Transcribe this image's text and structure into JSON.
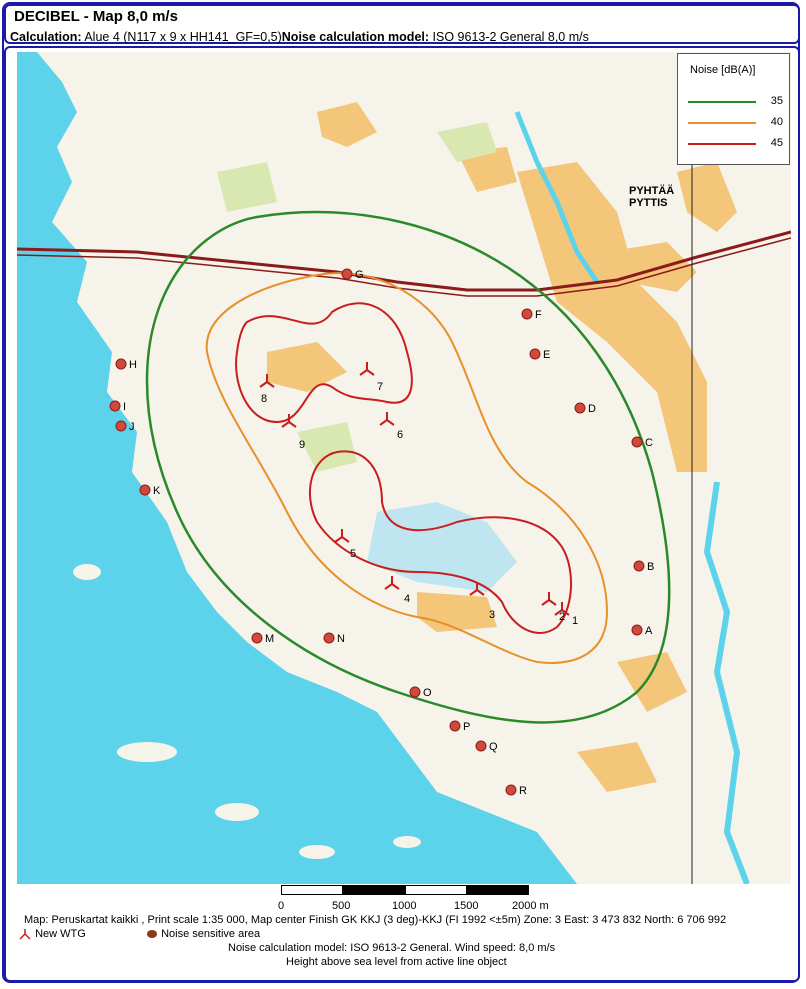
{
  "header": {
    "title": "DECIBEL - Map 8,0 m/s",
    "calc_label": "Calculation:",
    "calc_value": "Alue 4 (N117 x 9 x HH141_GF=0,5)",
    "model_label": "Noise calculation model:",
    "model_value": "ISO 9613-2 General 8,0 m/s"
  },
  "legend": {
    "title": "Noise [dB(A)]",
    "entries": [
      {
        "label": "35",
        "color": "#2a8a2a"
      },
      {
        "label": "40",
        "color": "#e8902a"
      },
      {
        "label": "45",
        "color": "#c81e1e"
      }
    ]
  },
  "map": {
    "place_label_1": "PYHTÄÄ",
    "place_label_2": "PYTTIS",
    "turbines": [
      "1",
      "2",
      "3",
      "4",
      "5",
      "6",
      "7",
      "8",
      "9"
    ],
    "receptors": [
      "A",
      "B",
      "C",
      "D",
      "E",
      "F",
      "G",
      "H",
      "I",
      "J",
      "K",
      "M",
      "N",
      "O",
      "P",
      "Q",
      "R"
    ],
    "colors": {
      "sea": "#5cd3ea",
      "land": "#f6f3ea",
      "field": "#f3c67a",
      "marsh": "#bfe6f0",
      "road": "#8b1a1a"
    }
  },
  "scale": {
    "ticks": [
      "0",
      "500",
      "1000",
      "1500",
      "2000 m"
    ]
  },
  "footer": {
    "line1": "Map: Peruskartat kaikki , Print scale 1:35 000, Map center Finish GK KKJ (3 deg)-KKJ (FI 1992 <±5m) Zone: 3  East: 3 473 832  North: 6 706 992",
    "legend_wtg": "New WTG",
    "legend_nsa": "Noise sensitive area",
    "line3": "Noise calculation model: ISO 9613-2 General. Wind speed: 8,0 m/s",
    "line4": "Height above sea level from active line object"
  }
}
